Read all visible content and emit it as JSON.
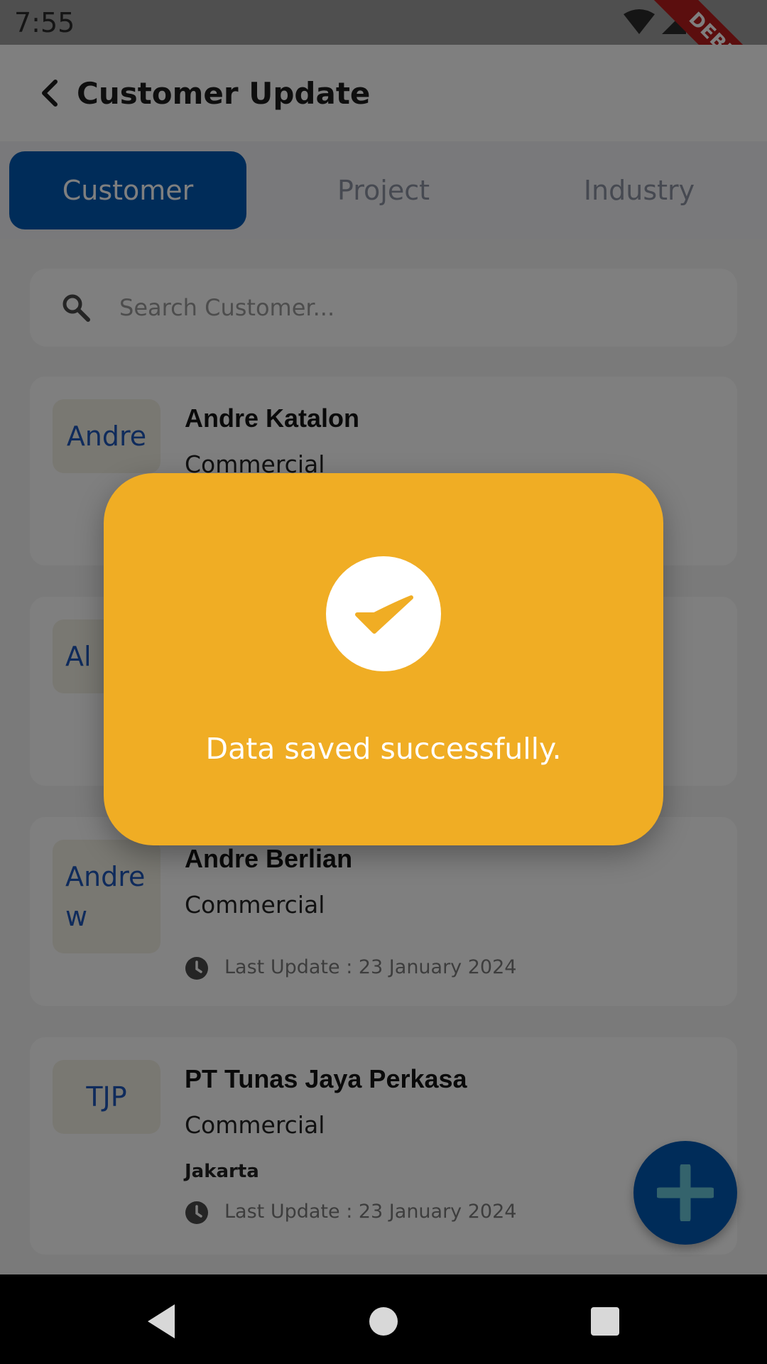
{
  "status_bar": {
    "time": "7:55",
    "debug_label": "DEBUG"
  },
  "app_bar": {
    "title": "Customer Update"
  },
  "tabs": [
    {
      "label": "Customer",
      "active": true
    },
    {
      "label": "Project",
      "active": false
    },
    {
      "label": "Industry",
      "active": false
    }
  ],
  "search": {
    "placeholder": "Search Customer..."
  },
  "customers": [
    {
      "avatar": "Andre",
      "name": "Andre Katalon",
      "type": "Commercial"
    },
    {
      "avatar": "Al"
    },
    {
      "avatar": "Andre w",
      "name": "Andre Berlian",
      "type": "Commercial",
      "last_update": "Last Update : 23 January 2024"
    },
    {
      "avatar": "TJP",
      "name": "PT Tunas Jaya Perkasa",
      "type": "Commercial",
      "city": "Jakarta",
      "last_update": "Last Update : 23 January 2024"
    }
  ],
  "dialog": {
    "message": "Data saved successfully."
  },
  "colors": {
    "primary": "#0059b3",
    "dialog": "#f0ad24",
    "avatar_text": "#1e56b8"
  },
  "icons": [
    "back-icon",
    "search-icon",
    "clock-icon",
    "plus-icon",
    "check-icon",
    "wifi-icon",
    "signal-icon",
    "battery-icon"
  ]
}
